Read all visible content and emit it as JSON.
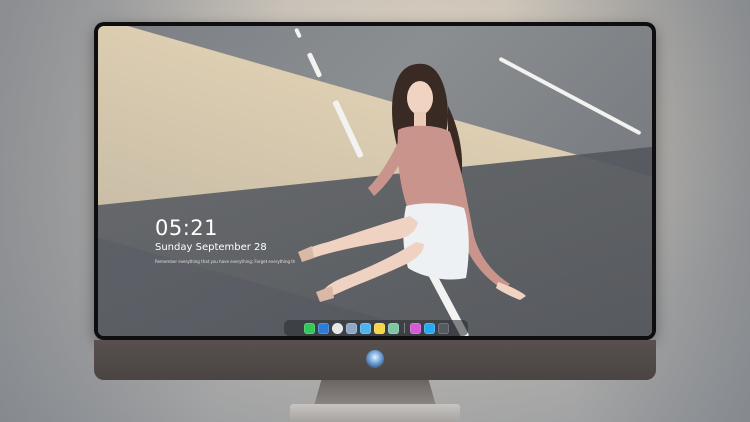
{
  "lock_screen": {
    "time": "05:21",
    "date": "Sunday September 28",
    "tagline": "Remember everything that you have everything; Forget everything that you don't have"
  },
  "dock": {
    "apps": [
      {
        "name": "messages-icon",
        "color": "#34c759"
      },
      {
        "name": "finder-icon",
        "color": "#2f7bd6"
      },
      {
        "name": "safari-icon",
        "color": "#e6e6e6"
      },
      {
        "name": "preview-icon",
        "color": "#8fa8c8"
      },
      {
        "name": "mail-icon",
        "color": "#4fb3f0"
      },
      {
        "name": "notes-icon",
        "color": "#f5d64a"
      },
      {
        "name": "photos-icon",
        "color": "#7fc6a4"
      },
      {
        "name": "itunes-icon",
        "color": "#d55ad6"
      },
      {
        "name": "app-store-icon",
        "color": "#2aa9f2"
      },
      {
        "name": "camera-icon",
        "color": "#555a60"
      }
    ]
  },
  "colors": {
    "monitor_chin": "#514b4a",
    "bezel": "#0e0e10",
    "road": "#7b7f84",
    "sunlight": "#e2d2b4"
  }
}
